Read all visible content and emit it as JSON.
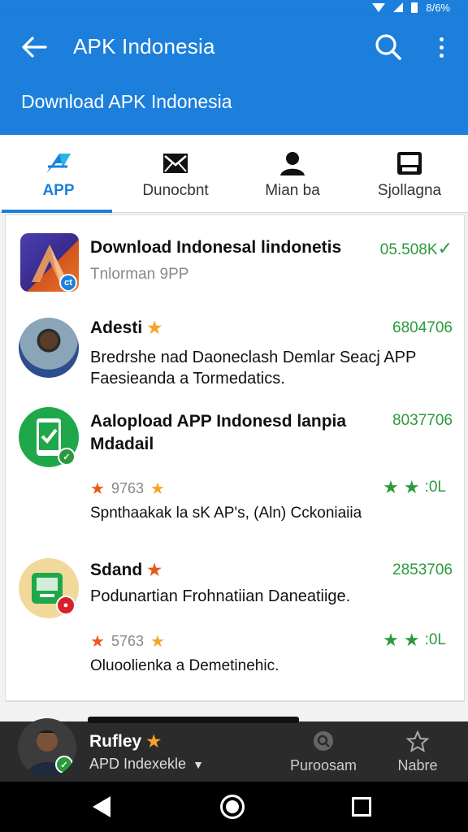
{
  "status_bar": {
    "battery_text": "8/6%"
  },
  "appbar": {
    "title": "APK Indonesia",
    "subtitle": "Download APK Indonesia"
  },
  "tabs": [
    {
      "label": "APP",
      "icon": "app-logo-icon",
      "active": true
    },
    {
      "label": "Dunocbnt",
      "icon": "envelope-icon",
      "active": false
    },
    {
      "label": "Mian ba",
      "icon": "person-icon",
      "active": false
    },
    {
      "label": "Sjollagna",
      "icon": "tray-icon",
      "active": false
    }
  ],
  "items": [
    {
      "title": "Download Indonesal lindonetis",
      "subtitle": "Tnlorman 9PP",
      "count": "05.508K",
      "check": "✓"
    },
    {
      "title": "Adesti",
      "count": "6804706",
      "description": "Bredrshe nad Daoneclash Demlar Seacj APP Faesieanda a Tormedatics."
    },
    {
      "title": "Aaloplоad APP Indonesd lanpia Mdadail",
      "count": "8037706",
      "rating": "9763",
      "right_rating": ":0L",
      "note": "Spnthaakak la sK AP's, (Aln) Cckoniaiia"
    },
    {
      "title": "Sdand",
      "count": "2853706",
      "description": "Podunartian Frohnatiian Daneatiige.",
      "rating": "5763",
      "right_rating": ":0L",
      "note": "Oluoolienka a Demetinehic."
    }
  ],
  "mini_player": {
    "name": "Rufley",
    "subtitle": "APD Indexekle",
    "action1": "Puroosam",
    "action2": "Nabre"
  },
  "colors": {
    "primary": "#1c7fdc",
    "green": "#2a9a3c",
    "star": "#f5a623"
  }
}
